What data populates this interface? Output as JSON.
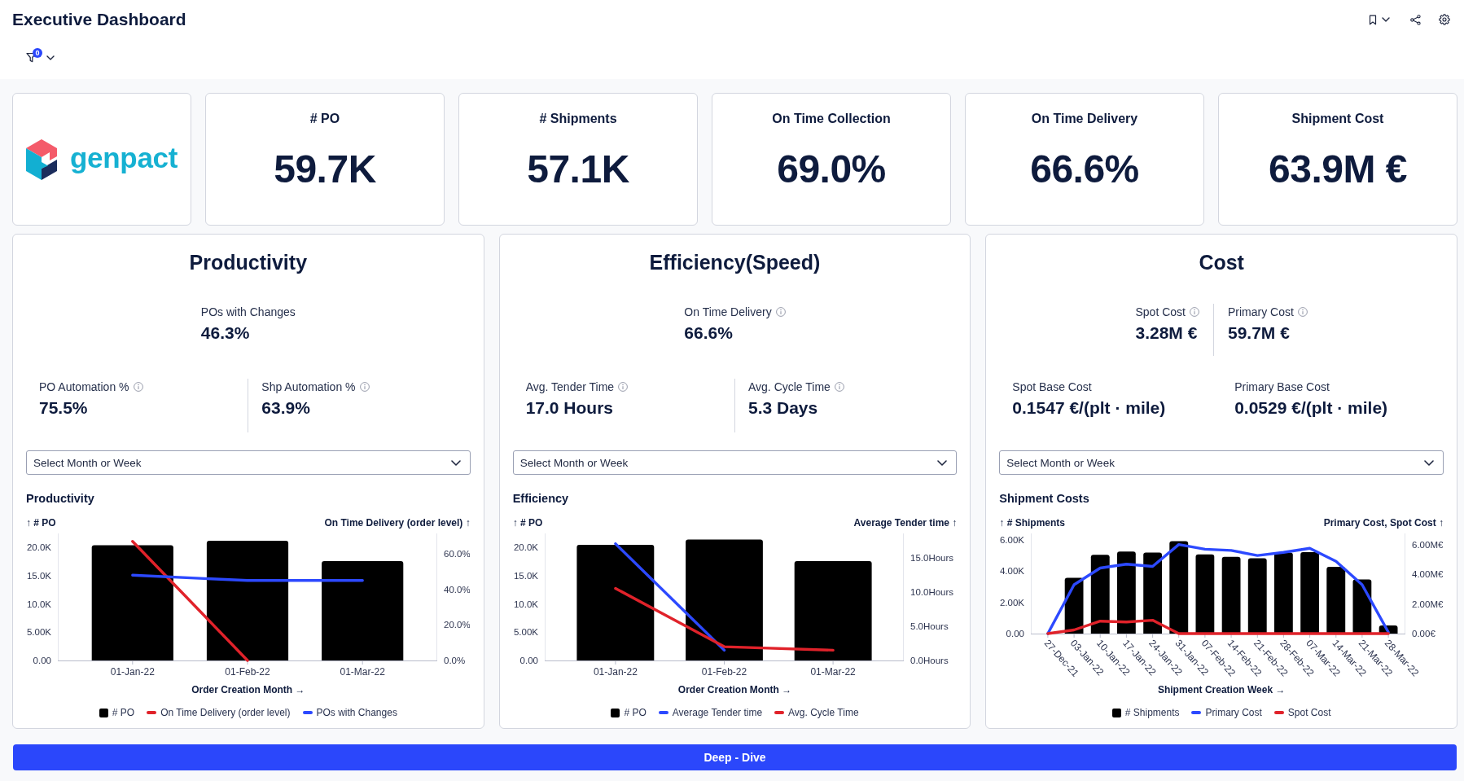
{
  "header": {
    "title": "Executive Dashboard"
  },
  "filters": {
    "active_count": "0"
  },
  "logo": {
    "wordmark": "genpact"
  },
  "kpis": [
    {
      "label": "# PO",
      "value": "59.7K"
    },
    {
      "label": "# Shipments",
      "value": "57.1K"
    },
    {
      "label": "On Time Collection",
      "value": "69.0%"
    },
    {
      "label": "On Time Delivery",
      "value": "66.6%"
    },
    {
      "label": "Shipment Cost",
      "value": "63.9M €"
    }
  ],
  "panels": [
    {
      "title": "Productivity",
      "headline": {
        "items": [
          {
            "label": "POs with Changes",
            "value": "46.3%",
            "info": false
          }
        ]
      },
      "details": {
        "divided": true,
        "items": [
          {
            "label": "PO Automation %",
            "value": "75.5%",
            "info": true
          },
          {
            "label": "Shp Automation %",
            "value": "63.9%",
            "info": true
          }
        ]
      },
      "period_select": {
        "placeholder": "Select Month or Week"
      },
      "chart_data": {
        "type": "bar",
        "title": "Productivity",
        "categories": [
          "01-Jan-22",
          "01-Feb-22",
          "01-Mar-22"
        ],
        "xlabel": "Order Creation Month →",
        "ylabel": "↑ # PO",
        "y2label": "On Time Delivery (order level) ↑",
        "ylim": [
          0,
          22500
        ],
        "yticks": [
          {
            "value": 0,
            "label": "0.00"
          },
          {
            "value": 5000,
            "label": "5.00K"
          },
          {
            "value": 10000,
            "label": "10.0K"
          },
          {
            "value": 15000,
            "label": "15.0K"
          },
          {
            "value": 20000,
            "label": "20.0K"
          }
        ],
        "y2lim": [
          0,
          71.5
        ],
        "y2ticks": [
          {
            "value": 0,
            "label": "0.0%"
          },
          {
            "value": 20,
            "label": "20.0%"
          },
          {
            "value": 40,
            "label": "40.0%"
          },
          {
            "value": 60,
            "label": "60.0%"
          }
        ],
        "series": [
          {
            "name": "# PO",
            "type": "bar",
            "color": "#000000",
            "values": [
              20400,
              21200,
              17600
            ]
          },
          {
            "name": "On Time Delivery (order level)",
            "type": "line",
            "axis": "y2",
            "color": "#e0222a",
            "values": [
              67,
              0,
              null
            ]
          },
          {
            "name": "POs with Changes",
            "type": "line",
            "axis": "y2",
            "color": "#2c49ff",
            "values": [
              48,
              45,
              45
            ]
          }
        ]
      }
    },
    {
      "title": "Efficiency(Speed)",
      "headline": {
        "items": [
          {
            "label": "On Time Delivery",
            "value": "66.6%",
            "info": true
          }
        ]
      },
      "details": {
        "divided": true,
        "items": [
          {
            "label": "Avg. Tender Time",
            "value": "17.0 Hours",
            "info": true
          },
          {
            "label": "Avg. Cycle Time",
            "value": "5.3 Days",
            "info": true
          }
        ]
      },
      "period_select": {
        "placeholder": "Select Month or Week"
      },
      "chart_data": {
        "type": "bar",
        "title": "Efficiency",
        "categories": [
          "01-Jan-22",
          "01-Feb-22",
          "01-Mar-22"
        ],
        "xlabel": "Order Creation Month →",
        "ylabel": "↑ # PO",
        "y2label": "Average Tender time ↑",
        "ylim": [
          0,
          22500
        ],
        "yticks": [
          {
            "value": 0,
            "label": "0.00"
          },
          {
            "value": 5000,
            "label": "5.00K"
          },
          {
            "value": 10000,
            "label": "10.0K"
          },
          {
            "value": 15000,
            "label": "15.0K"
          },
          {
            "value": 20000,
            "label": "20.0K"
          }
        ],
        "y2lim": [
          0,
          18.5
        ],
        "y2ticks": [
          {
            "value": 0,
            "label": "0.0Hours"
          },
          {
            "value": 5,
            "label": "5.0Hours"
          },
          {
            "value": 10,
            "label": "10.0Hours"
          },
          {
            "value": 15,
            "label": "15.0Hours"
          }
        ],
        "series": [
          {
            "name": "# PO",
            "type": "bar",
            "color": "#000000",
            "values": [
              20500,
              21400,
              17600
            ]
          },
          {
            "name": "Average Tender time",
            "type": "line",
            "axis": "y2",
            "color": "#2c49ff",
            "values": [
              17,
              1.5,
              null
            ]
          },
          {
            "name": "Avg. Cycle Time",
            "type": "line",
            "axis": "y2",
            "color": "#e0222a",
            "values": [
              10.5,
              2,
              1.5
            ]
          }
        ]
      }
    },
    {
      "title": "Cost",
      "headline": {
        "divided": true,
        "items": [
          {
            "label": "Spot Cost",
            "value": "3.28M €",
            "info": true
          },
          {
            "label": "Primary Cost",
            "value": "59.7M €",
            "info": true
          }
        ]
      },
      "details": {
        "divided": false,
        "items": [
          {
            "label": "Spot Base Cost",
            "value": "0.1547 €/(plt · mile)",
            "info": false
          },
          {
            "label": "Primary Base Cost",
            "value": "0.0529 €/(plt · mile)",
            "info": false
          }
        ]
      },
      "period_select": {
        "placeholder": "Select Month or Week"
      },
      "chart_data": {
        "type": "bar",
        "title": "Shipment Costs",
        "categories": [
          "27-Dec-21",
          "03-Jan-22",
          "10-Jan-22",
          "17-Jan-22",
          "24-Jan-22",
          "31-Jan-22",
          "07-Feb-22",
          "14-Feb-22",
          "21-Feb-22",
          "28-Feb-22",
          "07-Mar-22",
          "14-Mar-22",
          "21-Mar-22",
          "28-Mar-22"
        ],
        "xlabel": "Shipment Creation Week →",
        "ylabel": "↑ # Shipments",
        "y2label": "Primary Cost, Spot Cost ↑",
        "ylim": [
          0,
          6400
        ],
        "yticks": [
          {
            "value": 0,
            "label": "0.00"
          },
          {
            "value": 2000,
            "label": "2.00K"
          },
          {
            "value": 4000,
            "label": "4.00K"
          },
          {
            "value": 6000,
            "label": "6.00K"
          }
        ],
        "y2lim": [
          0,
          6770000
        ],
        "y2ticks": [
          {
            "value": 0,
            "label": "0.00€"
          },
          {
            "value": 2000000,
            "label": "2.00M€"
          },
          {
            "value": 4000000,
            "label": "4.00M€"
          },
          {
            "value": 6000000,
            "label": "6.00M€"
          }
        ],
        "series": [
          {
            "name": "# Shipments",
            "type": "bar",
            "color": "#000000",
            "values": [
              null,
              3560,
              5030,
              5240,
              5170,
              5900,
              5060,
              4900,
              4820,
              5170,
              5200,
              4260,
              3460,
              520
            ]
          },
          {
            "name": "Primary Cost",
            "type": "line",
            "axis": "y2",
            "color": "#2c49ff",
            "values": [
              0,
              3300000,
              4430000,
              4690000,
              4540000,
              6020000,
              5700000,
              5620000,
              5280000,
              5490000,
              5770000,
              4880000,
              3300000,
              100000
            ]
          },
          {
            "name": "Spot Cost",
            "type": "line",
            "axis": "y2",
            "color": "#e0222a",
            "values": [
              0,
              250000,
              840000,
              780000,
              900000,
              0,
              0,
              0,
              0,
              0,
              0,
              0,
              0,
              0
            ]
          }
        ]
      }
    }
  ],
  "deep_dive_button": {
    "label": "Deep - Dive"
  }
}
